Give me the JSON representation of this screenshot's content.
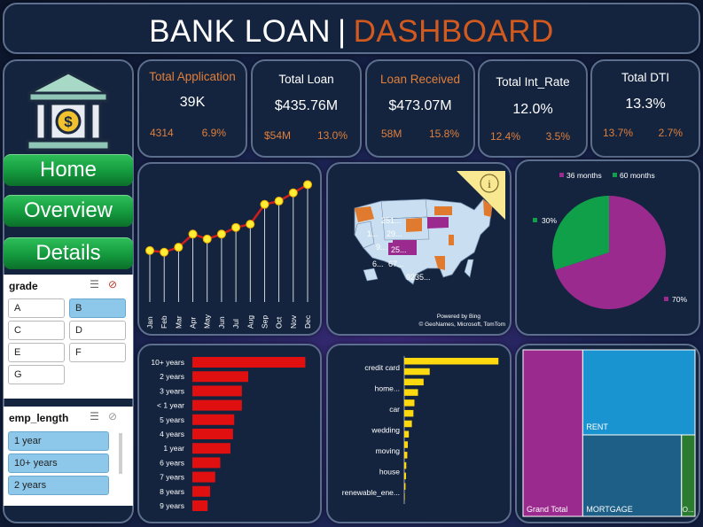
{
  "header": {
    "title_left": "BANK LOAN",
    "separator": "|",
    "title_right": "DASHBOARD"
  },
  "colors": {
    "accent_orange": "#d35a1e",
    "panel": "#14243f",
    "green_button": "#149a3e",
    "line_red": "#cc1f1f",
    "marker_yellow": "#ffee33"
  },
  "logo": {
    "icon": "bank-icon"
  },
  "nav": {
    "home": "Home",
    "overview": "Overview",
    "details": "Details"
  },
  "grade_slicer": {
    "title": "grade",
    "options": [
      "A",
      "B",
      "C",
      "D",
      "E",
      "F",
      "G"
    ],
    "selected": "B"
  },
  "emp_slicer": {
    "title": "emp_length",
    "options": [
      "1 year",
      "10+ years",
      "2 years"
    ]
  },
  "kpis": [
    {
      "title": "Total Application",
      "value": "39K",
      "a": "4314",
      "b": "6.9%"
    },
    {
      "title": "Total Loan",
      "value": "$435.76M",
      "a": "$54M",
      "b": "13.0%"
    },
    {
      "title": "Loan Received",
      "value": "$473.07M",
      "a": "58M",
      "b": "15.8%"
    },
    {
      "title": "Total Int_Rate",
      "value": "12.0%",
      "a": "12.4%",
      "b": "3.5%"
    },
    {
      "title": "Total DTI",
      "value": "13.3%",
      "a": "13.7%",
      "b": "2.7%"
    }
  ],
  "map": {
    "labels": [
      "251...",
      "29...",
      "1...",
      "9...",
      "25...",
      "6...",
      "67...",
      "9235..."
    ],
    "credit_line1": "Powered by Bing",
    "credit_line2": "© GeoNames, Microsoft, TomTom",
    "info_icon": "info-icon"
  },
  "chart_data": [
    {
      "type": "line",
      "title": "",
      "categories": [
        "Jan",
        "Feb",
        "Mar",
        "Apr",
        "May",
        "Jun",
        "Jul",
        "Aug",
        "Sep",
        "Oct",
        "Nov",
        "Dec"
      ],
      "values": [
        14,
        13.5,
        15,
        19,
        17.5,
        19,
        21,
        22,
        28,
        29,
        31.5,
        34
      ],
      "ylim": [
        0,
        36
      ],
      "grid": false
    },
    {
      "type": "pie",
      "legend": [
        "36 months",
        "60 months"
      ],
      "legend_position": "top",
      "slices": [
        {
          "name": "36 months",
          "value": 70,
          "label": "70%",
          "color": "#9b2a8f"
        },
        {
          "name": "60 months",
          "value": 30,
          "label": "30%",
          "color": "#11a04a"
        }
      ]
    },
    {
      "type": "bar",
      "orientation": "horizontal",
      "categories": [
        "10+ years",
        "2 years",
        "3 years",
        "< 1 year",
        "5 years",
        "4 years",
        "1 year",
        "6 years",
        "7 years",
        "8 years",
        "9 years"
      ],
      "values": [
        8900,
        4400,
        3900,
        3900,
        3300,
        3200,
        3000,
        2200,
        1800,
        1400,
        1200
      ],
      "xlim": [
        0,
        9500
      ],
      "color": "#e01010"
    },
    {
      "type": "bar",
      "orientation": "horizontal",
      "categories": [
        "credit card",
        "home...",
        "car",
        "wedding",
        "moving",
        "house",
        "renewable_ene..."
      ],
      "all_categories_count": 14,
      "values": [
        18500,
        5000,
        3800,
        2700,
        2000,
        1800,
        1500,
        900,
        700,
        600,
        400,
        350,
        250,
        100
      ],
      "xlim": [
        0,
        19500
      ],
      "color": "#ffd90f"
    },
    {
      "type": "heatmap",
      "subtype": "treemap",
      "cells": [
        {
          "name": "Grand Total",
          "value": 50,
          "color": "#9b2a8f"
        },
        {
          "name": "RENT",
          "value": 48,
          "color": "#1a94d0"
        },
        {
          "name": "MORTGAGE",
          "value": 44,
          "color": "#1d5f86"
        },
        {
          "name": "O...",
          "value": 2,
          "color": "#2a7a30"
        }
      ]
    }
  ]
}
